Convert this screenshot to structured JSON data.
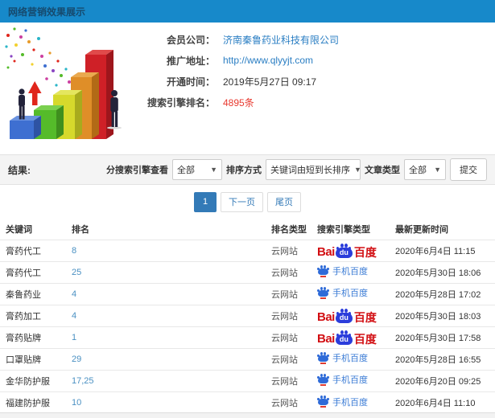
{
  "window": {
    "title": "网络营销效果展示"
  },
  "colors": {
    "titlebar_bg": "#1789ca",
    "titlebar_text": "#164a6e",
    "link_blue": "#2a7ec3",
    "highlight_red": "#e8392f",
    "active_page_bg": "#337ab7",
    "baidu_red": "#d20f13",
    "baidu_blue": "#2b3ddb",
    "mobile_baidu_blue": "#3a7bd5",
    "rank_blue": "#4a90c2",
    "filterbar_bg": "#f4f4f4"
  },
  "illustration": {
    "name": "growth-bar-chart-illustration"
  },
  "info": {
    "rows": [
      {
        "label": "会员公司：",
        "value": "济南秦鲁药业科技有限公司"
      },
      {
        "label": "推广地址：",
        "value": "http://www.qlyyjt.com"
      },
      {
        "label": "开通时间：",
        "value": "2019年5月27日 09:17"
      },
      {
        "label": "搜索引擎排名：",
        "value": "4895条"
      }
    ]
  },
  "filter": {
    "result_label": "结果:",
    "engine_filter_label": "分搜索引擎查看",
    "engine_filter_value": "全部",
    "sort_label": "排序方式",
    "sort_value": "关键词由短到长排序",
    "article_type_label": "文章类型",
    "article_type_value": "全部",
    "submit_label": "提交"
  },
  "pagination": {
    "current_page": "1",
    "next_label": "下一页",
    "last_label": "尾页"
  },
  "table": {
    "columns": [
      "关键词",
      "排名",
      "排名类型",
      "搜索引擎类型",
      "最新更新时间"
    ],
    "logos": {
      "baidu_pc": {
        "bai": "Bai",
        "du": "du",
        "cn": "百度"
      },
      "baidu_mobile": {
        "label": "手机百度"
      }
    },
    "rows": [
      {
        "keyword": "膏药代工",
        "rank": "8",
        "rank_type": "云网站",
        "engine": "baidu_pc",
        "time": "2020年6月4日 11:15"
      },
      {
        "keyword": "膏药代工",
        "rank": "25",
        "rank_type": "云网站",
        "engine": "baidu_mobile",
        "time": "2020年5月30日 18:06"
      },
      {
        "keyword": "秦鲁药业",
        "rank": "4",
        "rank_type": "云网站",
        "engine": "baidu_mobile",
        "time": "2020年5月28日 17:02"
      },
      {
        "keyword": "膏药加工",
        "rank": "4",
        "rank_type": "云网站",
        "engine": "baidu_pc",
        "time": "2020年5月30日 18:03"
      },
      {
        "keyword": "膏药贴牌",
        "rank": "1",
        "rank_type": "云网站",
        "engine": "baidu_pc",
        "time": "2020年5月30日 17:58"
      },
      {
        "keyword": "口罩贴牌",
        "rank": "29",
        "rank_type": "云网站",
        "engine": "baidu_mobile",
        "time": "2020年5月28日 16:55"
      },
      {
        "keyword": "金华防护服",
        "rank": "17,25",
        "rank_type": "云网站",
        "engine": "baidu_mobile",
        "time": "2020年6月20日 09:25"
      },
      {
        "keyword": "福建防护服",
        "rank": "10",
        "rank_type": "云网站",
        "engine": "baidu_mobile",
        "time": "2020年6月4日 11:10"
      }
    ]
  }
}
